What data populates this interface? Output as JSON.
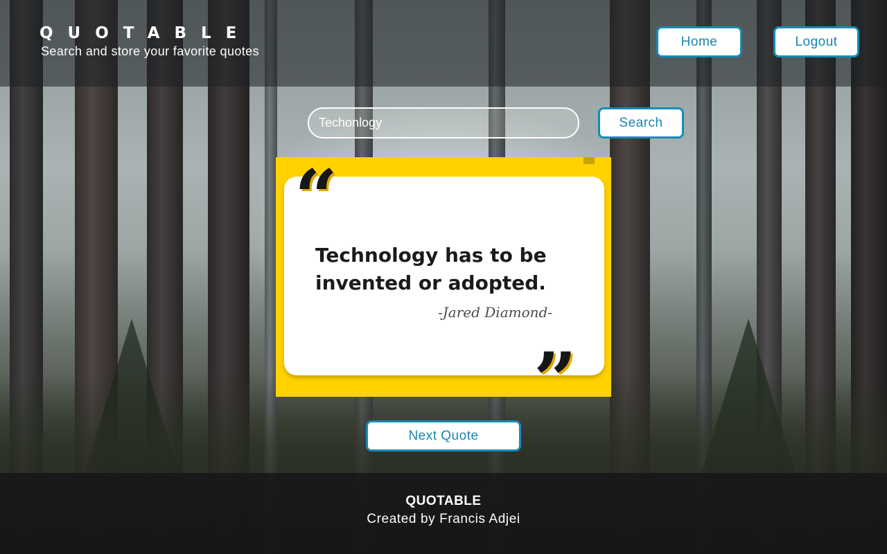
{
  "header": {
    "title": "QUOTABLE",
    "subtitle": "Search and store your favorite quotes",
    "nav": {
      "home_label": "Home",
      "logout_label": "Logout"
    }
  },
  "search": {
    "value": "Techonlogy",
    "button_label": "Search"
  },
  "quote": {
    "open_mark": "“",
    "close_mark": "”",
    "text": "Technology has to be invented or adopted.",
    "author": "-Jared Diamond-"
  },
  "next_button_label": "Next Quote",
  "footer": {
    "title": "QUOTABLE",
    "credit": "Created by Francis Adjei"
  },
  "colors": {
    "accent": "#178bb5",
    "card": "#ffd200"
  }
}
